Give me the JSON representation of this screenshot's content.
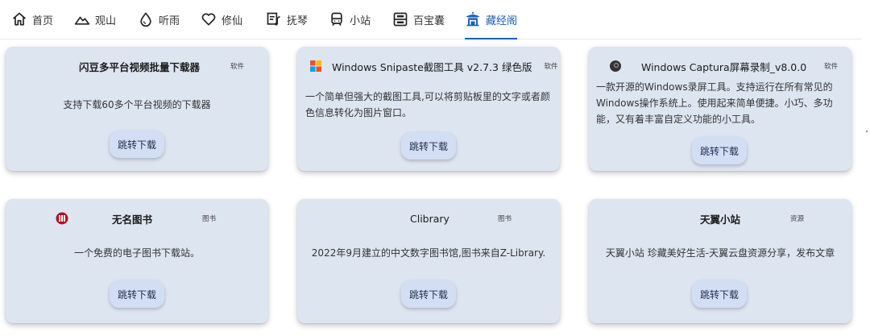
{
  "nav": {
    "items": [
      {
        "label": "首页",
        "icon": "home-icon"
      },
      {
        "label": "观山",
        "icon": "mountain-icon"
      },
      {
        "label": "听雨",
        "icon": "water-drop-icon"
      },
      {
        "label": "修仙",
        "icon": "heart-icon"
      },
      {
        "label": "抚琴",
        "icon": "music-note-icon"
      },
      {
        "label": "小站",
        "icon": "train-icon"
      },
      {
        "label": "百宝囊",
        "icon": "storage-box-icon"
      },
      {
        "label": "藏经阁",
        "icon": "pavilion-icon"
      }
    ],
    "active_index": 7,
    "accent_color": "#1a5fb4"
  },
  "cards": [
    {
      "title": "闪豆多平台视频批量下载器",
      "tag": "软件",
      "icon": null,
      "description": "支持下载60多个平台视频的下载器",
      "button": "跳转下载"
    },
    {
      "title": "Windows Snipaste截图工具 v2.7.3 绿色版",
      "tag": "软件",
      "icon": "windows-logo-icon",
      "description": "一个简单但强大的截图工具,可以将剪贴板里的文字或者颜色信息转化为图片窗口。",
      "button": "跳转下载"
    },
    {
      "title": "Windows Captura屏幕录制_v8.0.0",
      "tag": "软件",
      "icon": "captura-logo-icon",
      "description": "一款开源的Windows录屏工具。支持运行在所有常见的Windows操作系统上。使用起来简单便捷。小巧、多功能，又有着丰富自定义功能的小工具。",
      "button": "跳转下载"
    },
    {
      "title": "无名图书",
      "tag": "图书",
      "icon": "book-logo-icon",
      "description": "一个免费的电子图书下载站。",
      "button": "跳转下载"
    },
    {
      "title": "Clibrary",
      "tag": "图书",
      "icon": null,
      "description": "2022年9月建立的中文数字图书馆,图书来自Z-Library.",
      "button": "跳转下载"
    },
    {
      "title": "天翼小站",
      "tag": "资源",
      "icon": null,
      "description": "天翼小站 珍藏美好生活-天翼云盘资源分享，发布文章",
      "button": "跳转下载"
    }
  ]
}
